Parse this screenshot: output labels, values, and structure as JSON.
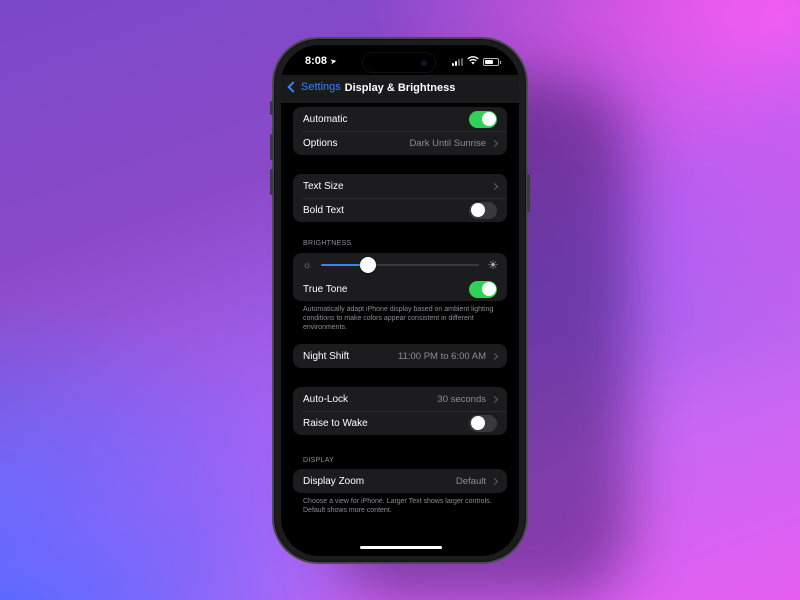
{
  "status_bar": {
    "time": "8:08",
    "location_icon": "location-arrow-icon",
    "signal_bars_active": 2,
    "signal_bars_total": 4,
    "wifi_icon": "wifi-icon",
    "battery_icon": "battery-icon"
  },
  "nav": {
    "back_label": "Settings",
    "title": "Display & Brightness"
  },
  "appearance_group": {
    "rows": [
      {
        "label": "Automatic",
        "type": "toggle",
        "on": true
      },
      {
        "label": "Options",
        "value": "Dark Until Sunrise",
        "type": "disclosure"
      }
    ]
  },
  "text_group": {
    "rows": [
      {
        "label": "Text Size",
        "type": "disclosure"
      },
      {
        "label": "Bold Text",
        "type": "toggle",
        "on": false
      }
    ]
  },
  "brightness": {
    "header": "BRIGHTNESS",
    "slider_value": 0.3,
    "min_icon": "sun-dim-icon",
    "max_icon": "sun-bright-icon",
    "true_tone": {
      "label": "True Tone",
      "on": true
    },
    "footer": "Automatically adapt iPhone display based on ambient lighting conditions to make colors appear consistent in different environments."
  },
  "night_shift": {
    "label": "Night Shift",
    "value": "11:00 PM to 6:00 AM"
  },
  "lock_group": {
    "rows": [
      {
        "label": "Auto-Lock",
        "value": "30 seconds",
        "type": "disclosure"
      },
      {
        "label": "Raise to Wake",
        "type": "toggle",
        "on": false
      }
    ]
  },
  "display": {
    "header": "DISPLAY",
    "zoom_label": "Display Zoom",
    "zoom_value": "Default",
    "footer": "Choose a view for iPhone. Larger Text shows larger controls. Default shows more content."
  },
  "colors": {
    "accent": "#3a82f7",
    "toggle_on": "#30d158",
    "toggle_off": "#39393d",
    "cell_bg": "#1c1c1e",
    "secondary_text": "#8e8e93"
  }
}
